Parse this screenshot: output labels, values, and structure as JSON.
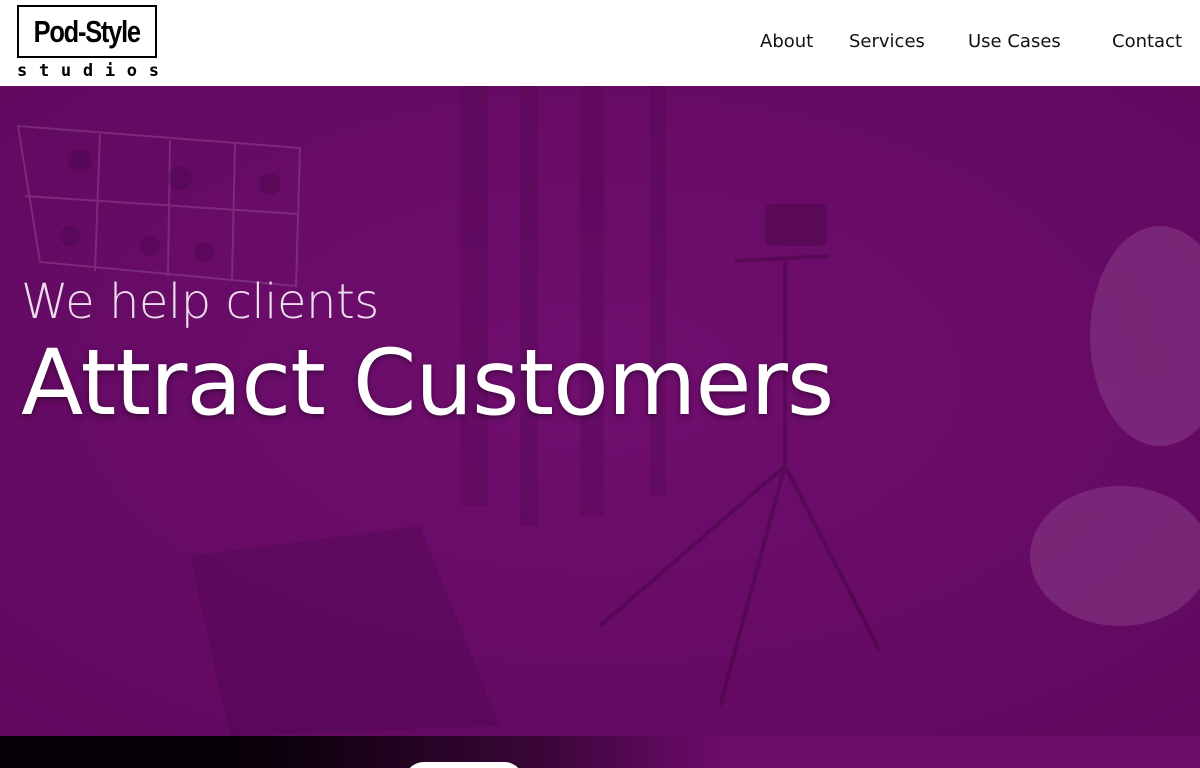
{
  "brand": {
    "name": "Pod-Style",
    "tagline_letters": [
      "s",
      "t",
      "u",
      "d",
      "i",
      "o",
      "s"
    ]
  },
  "nav": {
    "items": [
      {
        "label": "About"
      },
      {
        "label": "Services"
      },
      {
        "label": "Use Cases"
      },
      {
        "label": "Contact"
      }
    ]
  },
  "hero": {
    "subtitle": "We help clients",
    "title": "Attract Customers",
    "overlay_color": "#6b0b6a"
  },
  "colors": {
    "header_bg": "#ffffff",
    "text_dark": "#111111",
    "hero_text": "#ffffff"
  }
}
